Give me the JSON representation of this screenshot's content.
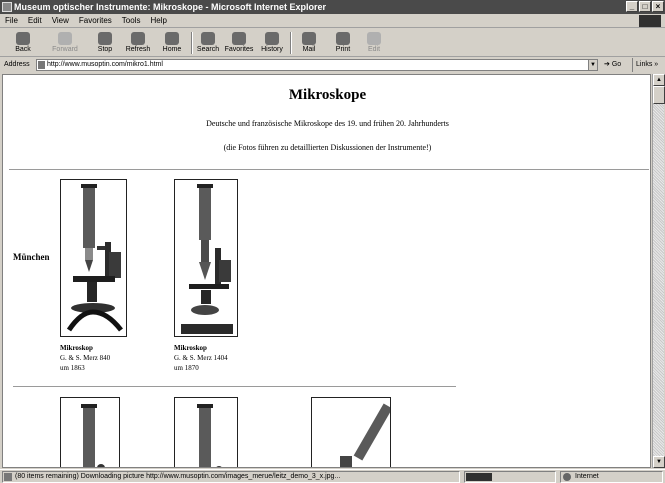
{
  "window": {
    "title": "Museum optischer Instrumente: Mikroskope - Microsoft Internet Explorer"
  },
  "menu": [
    "File",
    "Edit",
    "View",
    "Favorites",
    "Tools",
    "Help"
  ],
  "toolbar": [
    {
      "label": "Back",
      "icon": "back-arrow-icon",
      "enabled": true
    },
    {
      "label": "Forward",
      "icon": "forward-arrow-icon",
      "enabled": false
    },
    {
      "label": "Stop",
      "icon": "stop-icon",
      "enabled": true
    },
    {
      "label": "Refresh",
      "icon": "refresh-icon",
      "enabled": true
    },
    {
      "label": "Home",
      "icon": "home-icon",
      "enabled": true
    },
    {
      "label": "Search",
      "icon": "search-icon",
      "enabled": true
    },
    {
      "label": "Favorites",
      "icon": "favorites-icon",
      "enabled": true
    },
    {
      "label": "History",
      "icon": "history-icon",
      "enabled": true
    },
    {
      "label": "Mail",
      "icon": "mail-icon",
      "enabled": true
    },
    {
      "label": "Print",
      "icon": "print-icon",
      "enabled": true
    },
    {
      "label": "Edit",
      "icon": "edit-icon",
      "enabled": false
    }
  ],
  "address": {
    "label": "Address",
    "url": "http://www.musoptin.com/mikro1.html",
    "go": "Go",
    "links": "Links"
  },
  "page": {
    "title": "Mikroskope",
    "subtitle": "Deutsche und französische Mikroskope des 19. und frühen 20. Jahrhunderts",
    "note": "(die Fotos führen zu detaillierten Diskussionen der Instrumente!)",
    "row_label": "München",
    "items": [
      {
        "name": "Mikroskop",
        "maker": "G. & S. Merz 840",
        "date": "um 1863"
      },
      {
        "name": "Mikroskop",
        "maker": "G. & S. Merz 1404",
        "date": "um 1870"
      }
    ]
  },
  "status": {
    "message": "(80 items remaining) Downloading picture http://www.musoptin.com/images_merue/leitz_demo_3_x.jpg...",
    "progress": 0.3,
    "zone": "Internet"
  }
}
